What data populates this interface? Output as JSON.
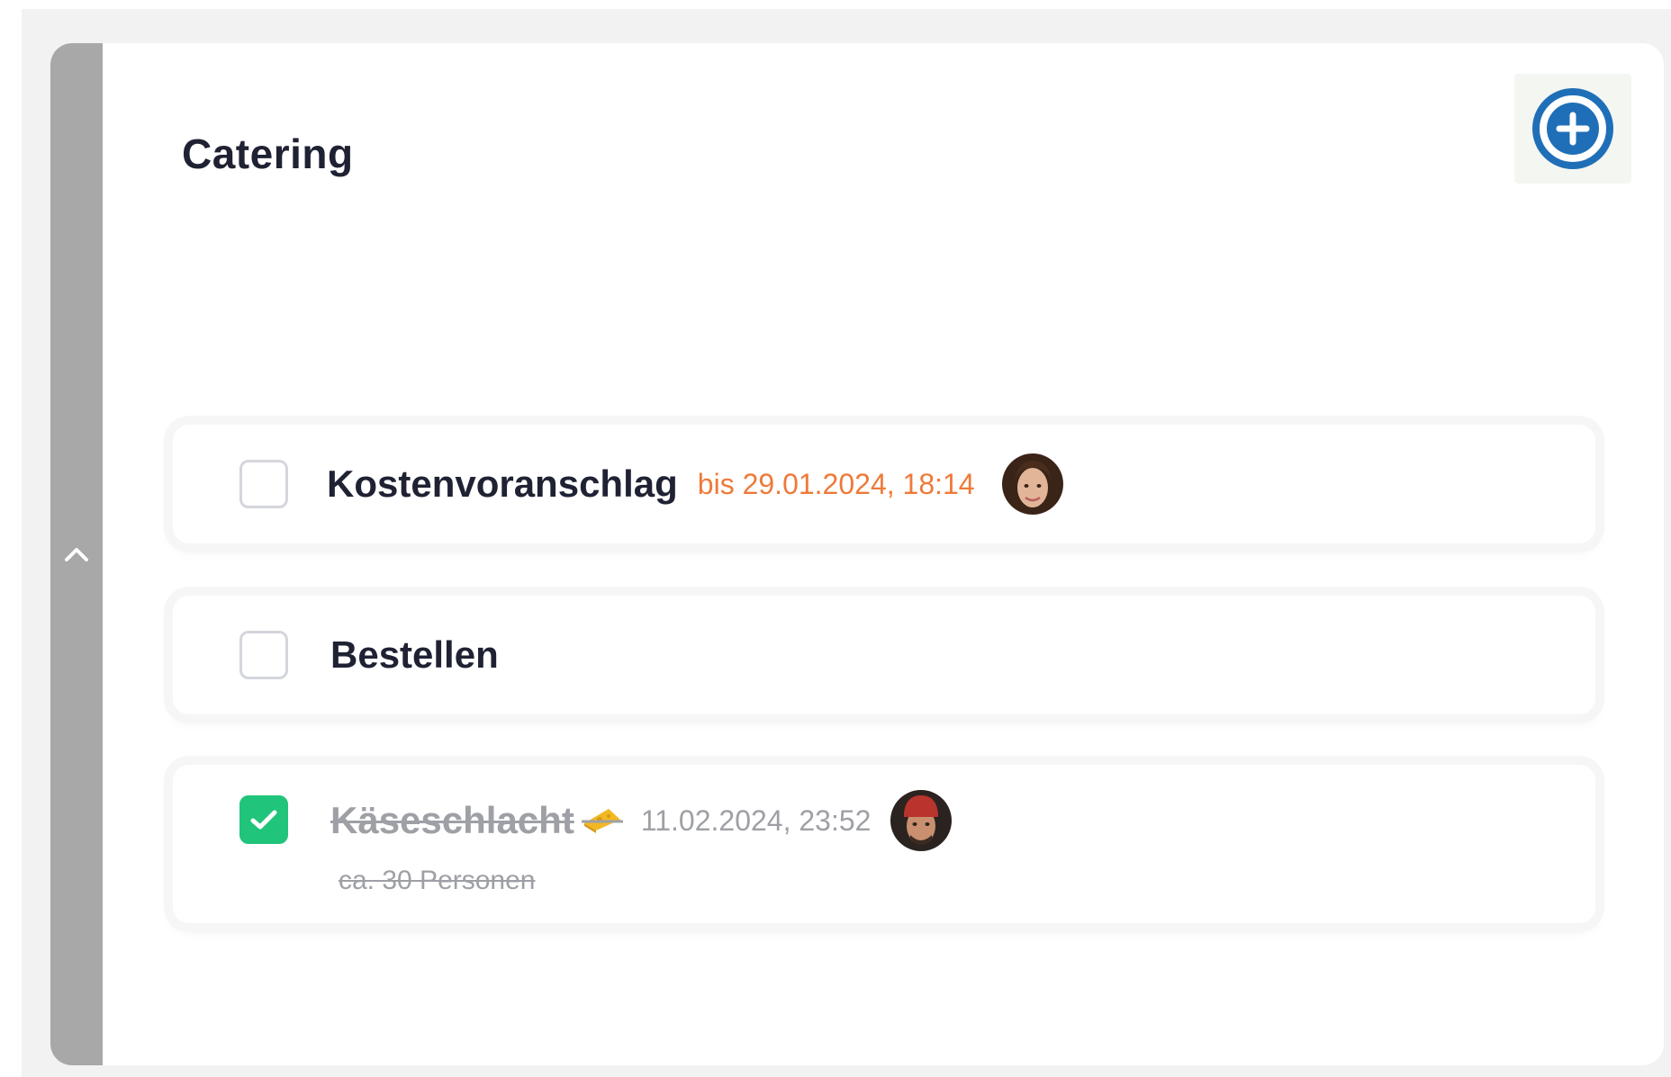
{
  "section": {
    "title": "Catering",
    "add_button_icon": "plus-circle-icon",
    "collapse_icon": "chevron-up-icon",
    "accent_color": "#1f6fb8"
  },
  "tasks": [
    {
      "title": "Kostenvoranschlag",
      "due": "bis 29.01.2024, 18:14",
      "checked": false,
      "avatar": "avatar-woman"
    },
    {
      "title": "Bestellen",
      "checked": false
    },
    {
      "title": "Käseschlacht",
      "title_icon": "cheese-icon",
      "completed_at": "11.02.2024, 23:52",
      "note": "ca. 30 Personen",
      "checked": true,
      "avatar": "avatar-man"
    }
  ],
  "colors": {
    "due": "#ee7a3a",
    "done_check": "#20c47a",
    "done_text": "#9ea0a6",
    "sidebar": "#a8a8a8"
  }
}
